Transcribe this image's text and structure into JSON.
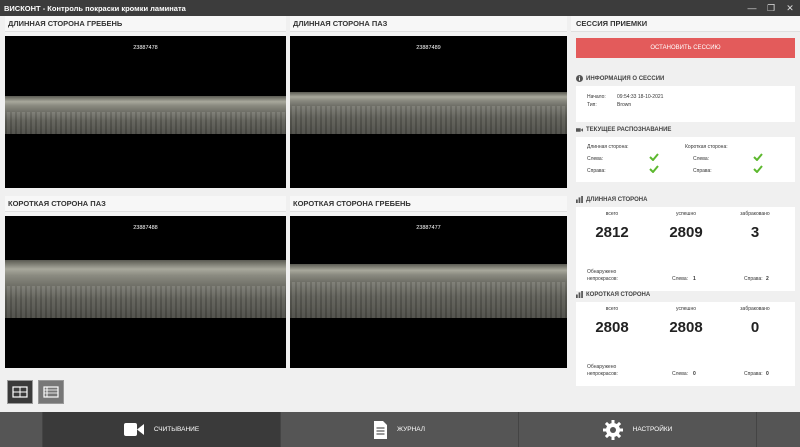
{
  "app": {
    "title": "ВИСКОНТ - Контроль покраски кромки ламината"
  },
  "cameras": [
    {
      "title": "ДЛИННАЯ СТОРОНА ГРЕБЕНЬ",
      "id": "23887478"
    },
    {
      "title": "ДЛИННАЯ СТОРОНА ПАЗ",
      "id": "23887489"
    },
    {
      "title": "КОРОТКАЯ СТОРОНА ПАЗ",
      "id": "23887488"
    },
    {
      "title": "КОРОТКАЯ СТОРОНА ГРЕБЕНЬ",
      "id": "23887477"
    }
  ],
  "session": {
    "title": "СЕССИЯ ПРИЕМКИ",
    "stop_label": "ОСТАНОВИТЬ СЕССИЮ",
    "info_title": "ИНФОРМАЦИЯ О СЕССИИ",
    "start_label": "Начало:",
    "start_value": "09:54:33 18-10-2021",
    "type_label": "Тип:",
    "type_value": "Brown"
  },
  "recognition": {
    "title": "ТЕКУЩЕЕ РАСПОЗНАВАНИЕ",
    "long_label": "Длинная сторона:",
    "short_label": "Короткая сторона:",
    "left_label": "Слева:",
    "right_label": "Справа:"
  },
  "long_side": {
    "title": "ДЛИННАЯ СТОРОНА",
    "total_label": "всего",
    "ok_label": "успешно",
    "rejected_label": "забраковано",
    "total": "2812",
    "ok": "2809",
    "rejected": "3",
    "unpainted_label": "Обнаружено непрокрасов:",
    "left_label": "Слева:",
    "left_value": "1",
    "right_label": "Справа:",
    "right_value": "2"
  },
  "short_side": {
    "title": "КОРОТКАЯ СТОРОНА",
    "total_label": "всего",
    "ok_label": "успешно",
    "rejected_label": "забраковано",
    "total": "2808",
    "ok": "2808",
    "rejected": "0",
    "unpainted_label": "Обнаружено непрокрасов:",
    "left_label": "Слева:",
    "left_value": "0",
    "right_label": "Справа:",
    "right_value": "0"
  },
  "nav": {
    "reading": "СЧИТЫВАНИЕ",
    "journal": "ЖУРНАЛ",
    "settings": "НАСТРОЙКИ"
  },
  "colors": {
    "accent_red": "#e35b5b",
    "check_green": "#5cb82e",
    "nav_bg": "#555555",
    "nav_active": "#3a3a3a"
  },
  "icons": [
    "info-icon",
    "camera-icon",
    "bar-chart-icon",
    "check-icon",
    "video-camera-icon",
    "document-icon",
    "gear-icon",
    "grid-layout-icon",
    "single-layout-icon"
  ]
}
